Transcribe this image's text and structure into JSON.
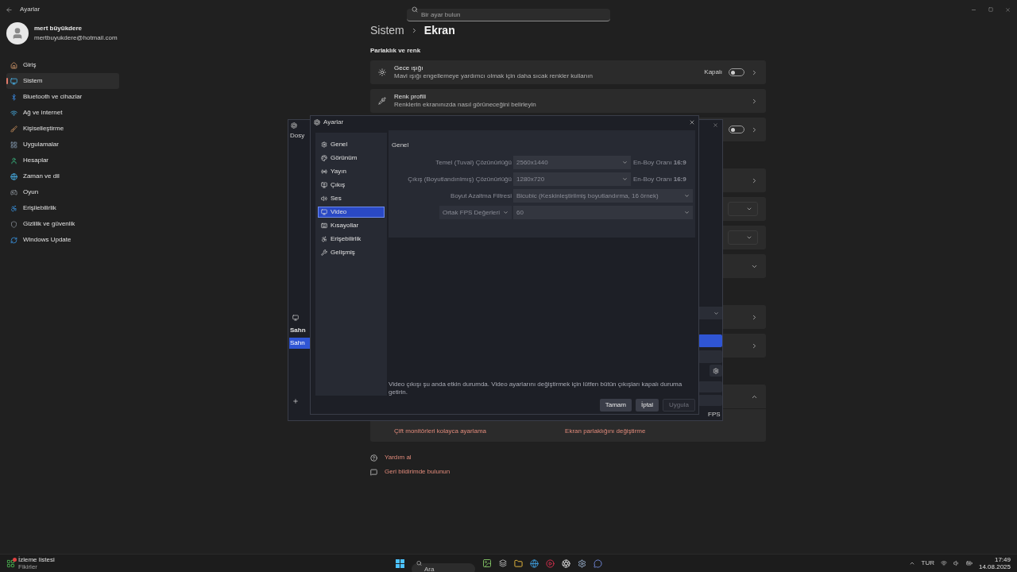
{
  "settings_window": {
    "title": "Ayarlar",
    "search": {
      "placeholder": "Bir ayar bulun"
    },
    "profile": {
      "name": "mert büyükdere",
      "email": "mertbuyukdere@hotmail.com"
    },
    "nav": [
      {
        "label": "Giriş",
        "selected": false
      },
      {
        "label": "Sistem",
        "selected": true
      },
      {
        "label": "Bluetooth ve cihazlar",
        "selected": false
      },
      {
        "label": "Ağ ve internet",
        "selected": false
      },
      {
        "label": "Kişiselleştirme",
        "selected": false
      },
      {
        "label": "Uygulamalar",
        "selected": false
      },
      {
        "label": "Hesaplar",
        "selected": false
      },
      {
        "label": "Zaman ve dil",
        "selected": false
      },
      {
        "label": "Oyun",
        "selected": false
      },
      {
        "label": "Erişilebilirlik",
        "selected": false
      },
      {
        "label": "Gizlilik ve güvenlik",
        "selected": false
      },
      {
        "label": "Windows Update",
        "selected": false
      }
    ],
    "breadcrumb": [
      "Sistem",
      "Ekran"
    ],
    "sections": [
      {
        "heading": "Parlaklık ve renk",
        "cards": [
          {
            "kind": "toggle",
            "title": "Gece ışığı",
            "description": "Mavi ışığı engellemeye yardımcı olmak için daha sıcak renkler kullanın",
            "state_label": "Kapalı",
            "on": false
          },
          {
            "kind": "link",
            "title": "Renk profili",
            "description": "Renklerin ekranınızda nasıl görüneceğini belirleyin"
          },
          {
            "kind": "toggle",
            "on": false
          }
        ]
      },
      {
        "cards": [
          {
            "kind": "link"
          },
          {
            "kind": "dropdown"
          },
          {
            "kind": "dropdown"
          },
          {
            "kind": "expand",
            "expanded": false
          }
        ]
      },
      {
        "cards": [
          {
            "kind": "link"
          },
          {
            "kind": "link"
          }
        ]
      },
      {
        "cards": [
          {
            "kind": "expand",
            "expanded": true,
            "links": [
              "Çift monitörleri kolayca ayarlama",
              "Ekran parlaklığını değiştirme"
            ]
          }
        ]
      }
    ],
    "footer_links": [
      "Yardım al",
      "Geri bildirimde bulunun"
    ]
  },
  "obs_main": {
    "menu_item": "Dosy",
    "scenes_header": "Sahn",
    "scenes": [
      {
        "label": "Sahn",
        "selected": true
      }
    ],
    "status": "FPS"
  },
  "obs_settings": {
    "title": "Ayarlar",
    "nav": [
      {
        "label": "Genel",
        "selected": false
      },
      {
        "label": "Görünüm",
        "selected": false
      },
      {
        "label": "Yayın",
        "selected": false
      },
      {
        "label": "Çıkış",
        "selected": false
      },
      {
        "label": "Ses",
        "selected": false
      },
      {
        "label": "Video",
        "selected": true
      },
      {
        "label": "Kısayollar",
        "selected": false
      },
      {
        "label": "Erişebilirlik",
        "selected": false
      },
      {
        "label": "Gelişmiş",
        "selected": false
      }
    ],
    "group_title": "Genel",
    "fields": [
      {
        "kind": "text-label",
        "label": "Temel (Tuval) Çözünürlüğü",
        "value": "2560x1440",
        "aspect": "En-Boy Oranı **16:9**",
        "disabled": true
      },
      {
        "kind": "text-label",
        "label": "Çıkış (Boyutlandırılmış) Çözünürlüğü",
        "value": "1280x720",
        "aspect": "En-Boy Oranı **16:9**",
        "disabled": true
      },
      {
        "kind": "text-label",
        "label": "Boyut Azaltma Filtresi",
        "value": "Bicubic (Keskinleştirilmiş boyutlandırma, 16 örnek)",
        "disabled": true
      },
      {
        "kind": "select-label",
        "label": "Ortak FPS Değerleri",
        "value": "60",
        "disabled": true
      }
    ],
    "message": "Video çıkışı şu anda etkin durumda. Video ayarlarını değiştirmek için lütfen bütün çıkışları kapalı duruma getirin.",
    "buttons": [
      {
        "label": "Tamam",
        "disabled": false
      },
      {
        "label": "İptal",
        "disabled": false
      },
      {
        "label": "Uygula",
        "disabled": true
      }
    ]
  },
  "taskbar": {
    "widget": {
      "title": "İzleme listesi",
      "subtitle": "Fikirler"
    },
    "search": {
      "placeholder": "Ara"
    },
    "language": "TUR",
    "time": "17:49",
    "date": "14.08.2025"
  }
}
